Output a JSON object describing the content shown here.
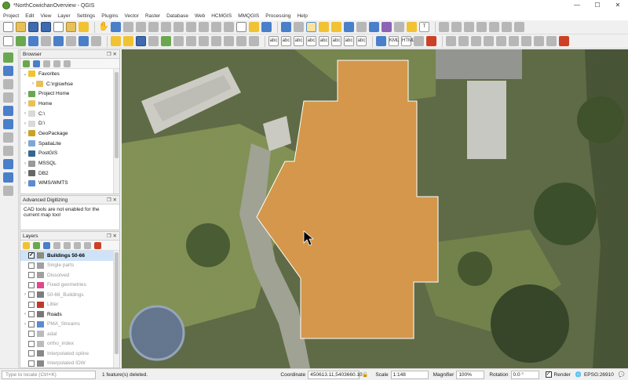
{
  "window": {
    "title": "*NorthCowichanOverview - QGIS",
    "controls": [
      "—",
      "☐",
      "✕"
    ]
  },
  "menu": [
    "Project",
    "Edit",
    "View",
    "Layer",
    "Settings",
    "Plugins",
    "Vector",
    "Raster",
    "Database",
    "Web",
    "HCMGIS",
    "MMQGIS",
    "Processing",
    "Help"
  ],
  "panels": {
    "browser": {
      "title": "Browser",
      "items": [
        {
          "label": "Favorites",
          "icon": "star-icon",
          "color": "#f1c232",
          "expanded": true,
          "indent": 0
        },
        {
          "label": "C:\\rgiswhse",
          "icon": "folder-icon",
          "color": "#e8c05a",
          "expanded": false,
          "indent": 1
        },
        {
          "label": "Project Home",
          "icon": "project-icon",
          "color": "#6aa84f",
          "expanded": false,
          "indent": 0
        },
        {
          "label": "Home",
          "icon": "folder-icon",
          "color": "#e8c05a",
          "expanded": false,
          "indent": 0
        },
        {
          "label": "C:\\",
          "icon": "drive-icon",
          "color": "#d9d9d9",
          "expanded": false,
          "indent": 0
        },
        {
          "label": "D:\\",
          "icon": "drive-icon",
          "color": "#d9d9d9",
          "expanded": false,
          "indent": 0
        },
        {
          "label": "GeoPackage",
          "icon": "geopackage-icon",
          "color": "#c9a227",
          "expanded": false,
          "indent": 0
        },
        {
          "label": "SpatiaLite",
          "icon": "spatialite-icon",
          "color": "#7fa6d8",
          "expanded": false,
          "indent": 0
        },
        {
          "label": "PostGIS",
          "icon": "postgis-icon",
          "color": "#336791",
          "expanded": false,
          "indent": 0
        },
        {
          "label": "MSSQL",
          "icon": "mssql-icon",
          "color": "#999999",
          "expanded": false,
          "indent": 0
        },
        {
          "label": "DB2",
          "icon": "db2-icon",
          "color": "#666666",
          "expanded": false,
          "indent": 0
        },
        {
          "label": "WMS/WMTS",
          "icon": "wms-icon",
          "color": "#5b8bd0",
          "expanded": false,
          "indent": 0
        }
      ]
    },
    "digitizing": {
      "title": "Advanced Digitizing",
      "message": "CAD tools are not enabled for the current map tool"
    },
    "layers": {
      "title": "Layers",
      "items": [
        {
          "label": "Buildings 50-66",
          "checked": true,
          "swatch": "#8c8c7a",
          "style": "bold",
          "indent": 0,
          "selected": true
        },
        {
          "label": "Single parts",
          "checked": false,
          "swatch": "#a0a0a0",
          "style": "gray",
          "indent": 0
        },
        {
          "label": "Dissolved",
          "checked": false,
          "swatch": "#a0a0a0",
          "style": "gray",
          "indent": 0
        },
        {
          "label": "Fixed geometries",
          "checked": false,
          "swatch": "#e2478c",
          "style": "gray",
          "indent": 0
        },
        {
          "label": "50-66_Buildings",
          "checked": false,
          "swatch": "#7d7d7d",
          "style": "gray",
          "indent": 0,
          "expandable": true
        },
        {
          "label": "Litter",
          "checked": false,
          "swatch": "#c0392b",
          "style": "gray",
          "indent": 0
        },
        {
          "label": "Roads",
          "checked": false,
          "swatch": "#777777",
          "style": "normal",
          "indent": 0,
          "expandable": true
        },
        {
          "label": "PMA_Streams",
          "checked": false,
          "swatch": "#5b8bd0",
          "style": "gray",
          "indent": 0,
          "expandable": true
        },
        {
          "label": "adal",
          "checked": false,
          "swatch": "#bbbbbb",
          "style": "gray",
          "indent": 0
        },
        {
          "label": "ortho_index",
          "checked": false,
          "swatch": "#bbbbbb",
          "style": "gray",
          "indent": 0
        },
        {
          "label": "Interpolated spline",
          "checked": false,
          "swatch": "#888888",
          "style": "gray",
          "indent": 0
        },
        {
          "label": "Interpolated IDW",
          "checked": false,
          "swatch": "#888888",
          "style": "gray",
          "indent": 0
        }
      ]
    }
  },
  "status": {
    "locator_placeholder": "Type to locate (Ctrl+K)",
    "message": "1 feature(s) deleted.",
    "coordinate_label": "Coordinate",
    "coordinate": "450613.11,5403660.10",
    "scale_label": "Scale",
    "scale": "1:148",
    "magnifier_label": "Magnifier",
    "magnifier": "100%",
    "rotation_label": "Rotation",
    "rotation": "0.0 °",
    "render_label": "Render",
    "crs": "EPSG:26910"
  },
  "colors": {
    "building_fill": "#d4974b",
    "building_stroke": "#ffffff",
    "map_base": "#4e5a34"
  }
}
